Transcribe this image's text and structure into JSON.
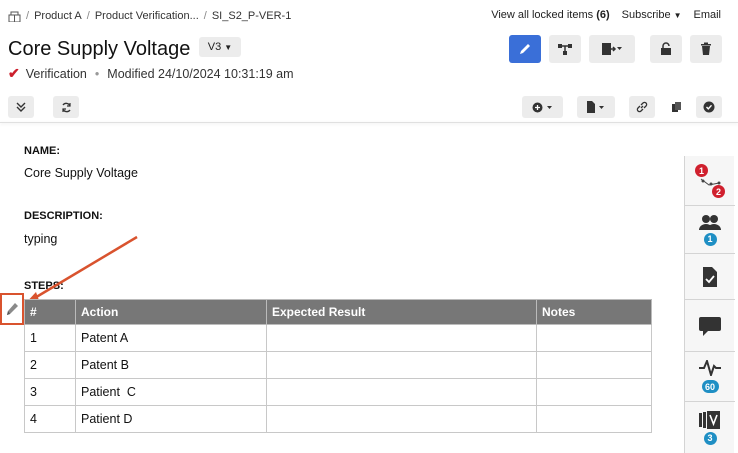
{
  "breadcrumb": {
    "items": [
      "Product A",
      "Product Verification...",
      "SI_S2_P-VER-1"
    ]
  },
  "topbar": {
    "locked_label": "View all locked items",
    "locked_count": "(6)",
    "subscribe": "Subscribe",
    "email": "Email"
  },
  "header": {
    "title": "Core Supply Voltage",
    "version": "V3",
    "type": "Verification",
    "separator": "•",
    "modified": "Modified 24/10/2024 10:31:19 am"
  },
  "fields": {
    "name_label": "NAME:",
    "name_value": "Core Supply Voltage",
    "description_label": "DESCRIPTION:",
    "description_value": "typing",
    "steps_label": "STEPS:"
  },
  "steps_table": {
    "headers": [
      "#",
      "Action",
      "Expected Result",
      "Notes"
    ],
    "rows": [
      [
        "1",
        "Patent A",
        "",
        ""
      ],
      [
        "2",
        "Patent B",
        "",
        ""
      ],
      [
        "3",
        "Patient  C",
        "",
        ""
      ],
      [
        "4",
        "Patient D",
        "",
        ""
      ]
    ]
  },
  "side_panel": {
    "relations_badges": [
      "1",
      "2"
    ],
    "reviewers_badge": "1",
    "activity_badge": "60",
    "versions_badge": "3"
  },
  "colors": {
    "primary": "#3a6fd8",
    "annotation": "#d9532e",
    "header_bg": "#777777",
    "badge_red": "#d0202e",
    "badge_blue": "#1f8fc4"
  },
  "icons": [
    "home-icon",
    "edit-icon",
    "relations-icon",
    "export-icon",
    "lock-icon",
    "trash-icon",
    "collapse-icon",
    "refresh-icon",
    "add-icon",
    "document-icon",
    "link-icon",
    "copy-icon",
    "check-circle-icon",
    "pencil-icon",
    "reviewers-icon",
    "test-run-icon",
    "comments-icon",
    "activity-icon",
    "versions-icon"
  ]
}
